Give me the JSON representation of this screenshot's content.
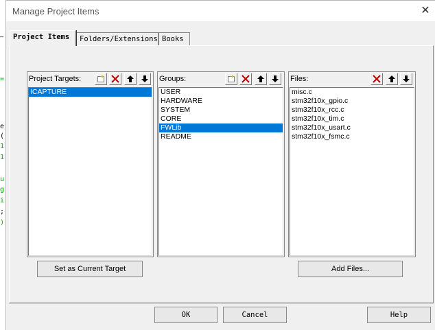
{
  "dialog": {
    "title": "Manage Project Items"
  },
  "tabs": [
    {
      "label": "Project Items",
      "active": true
    },
    {
      "label": "Folders/Extensions",
      "active": false
    },
    {
      "label": "Books",
      "active": false
    }
  ],
  "targets": {
    "label": "Project Targets:",
    "items": [
      "ICAPTURE"
    ],
    "selected_index": 0,
    "set_button": "Set as Current Target"
  },
  "groups": {
    "label": "Groups:",
    "items": [
      "USER",
      "HARDWARE",
      "SYSTEM",
      "CORE",
      "FWLib",
      "README"
    ],
    "selected_index": 4
  },
  "files": {
    "label": "Files:",
    "items": [
      "misc.c",
      "stm32f10x_gpio.c",
      "stm32f10x_rcc.c",
      "stm32f10x_tim.c",
      "stm32f10x_usart.c",
      "stm32f10x_fsmc.c"
    ],
    "add_button": "Add Files..."
  },
  "footer": {
    "ok": "OK",
    "cancel": "Cancel",
    "help": "Help"
  },
  "icons": {
    "new": "new-item-icon",
    "delete": "delete-x-icon",
    "up": "move-up-arrow-icon",
    "down": "move-down-arrow-icon",
    "close": "close-icon"
  },
  "colors": {
    "selection": "#0078d7",
    "delete_red": "#c00000"
  }
}
